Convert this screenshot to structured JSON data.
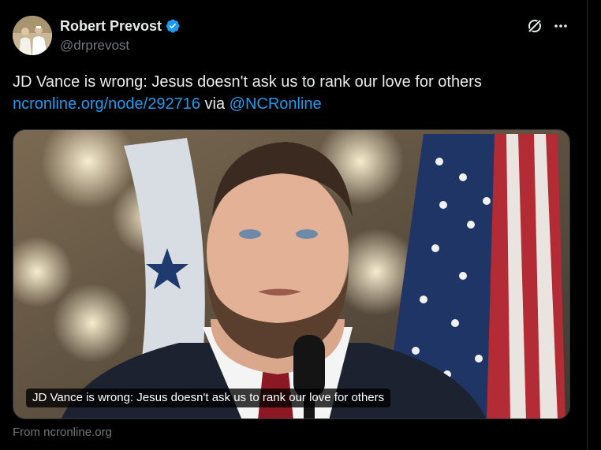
{
  "author": {
    "display_name": "Robert Prevost",
    "handle": "@drprevost",
    "verified": true
  },
  "header_icons": {
    "grok": "grok-icon",
    "more": "more-icon"
  },
  "tweet": {
    "text": "JD Vance is wrong: Jesus doesn't ask us to rank our love for others",
    "link_text": "ncronline.org/node/292716",
    "via_text": " via ",
    "mention": "@NCRonline"
  },
  "card": {
    "caption": "JD Vance is wrong: Jesus doesn't ask us to rank our love for others",
    "source": "From ncronline.org"
  },
  "colors": {
    "background": "#000000",
    "text": "#e7e9ea",
    "muted": "#71767b",
    "link": "#1d9bf0",
    "verified": "#1d9bf0"
  }
}
